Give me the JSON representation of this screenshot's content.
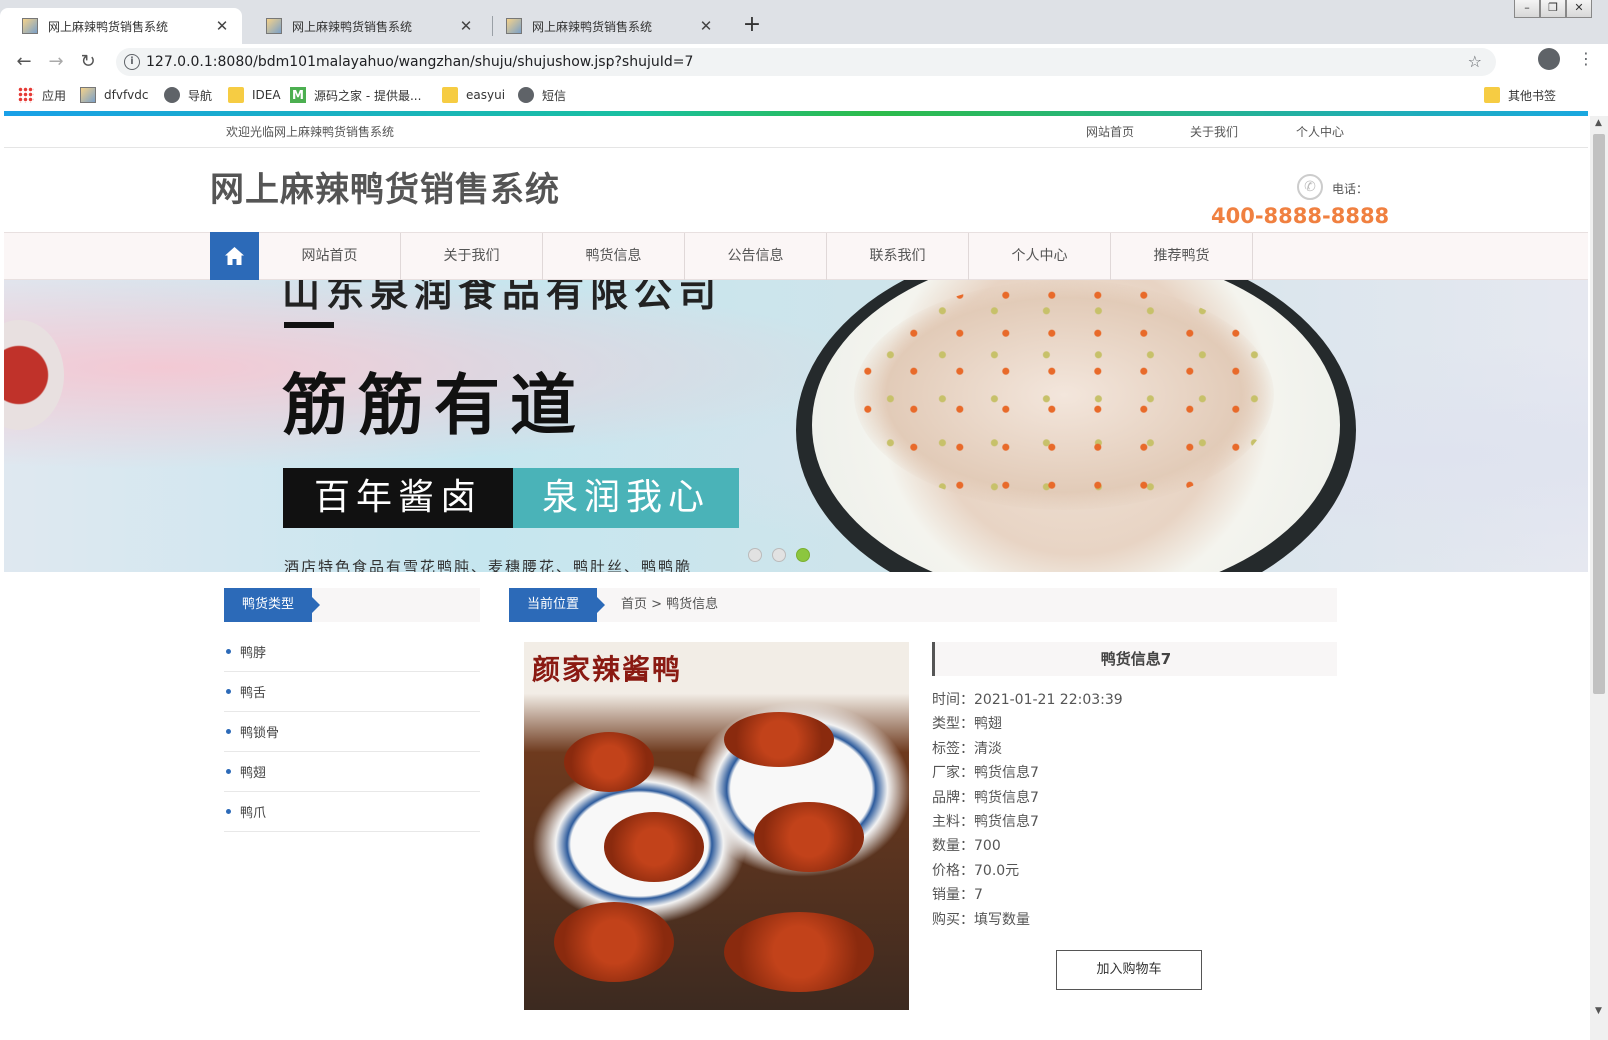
{
  "browser": {
    "tabs": [
      {
        "title": "网上麻辣鸭货销售系统",
        "active": true
      },
      {
        "title": "网上麻辣鸭货销售系统",
        "active": false
      },
      {
        "title": "网上麻辣鸭货销售系统",
        "active": false
      }
    ],
    "new_tab": "+",
    "url": "127.0.0.1:8080/bdm101malayahuo/wangzhan/shuju/shujushow.jsp?shujuId=7",
    "bookmarks": [
      {
        "label": "应用",
        "icon": "apps-icon"
      },
      {
        "label": "dfvfvdc",
        "icon": "image-icon"
      },
      {
        "label": "导航",
        "icon": "globe-icon"
      },
      {
        "label": "IDEA",
        "icon": "folder-icon"
      },
      {
        "label": "源码之家 - 提供最...",
        "icon": "m-icon"
      },
      {
        "label": "easyui",
        "icon": "folder-icon"
      },
      {
        "label": "短信",
        "icon": "globe-icon"
      }
    ],
    "other_bookmarks": "其他书签"
  },
  "site": {
    "welcome": "欢迎光临网上麻辣鸭货销售系统",
    "top_links": [
      "网站首页",
      "关于我们",
      "个人中心"
    ],
    "name": "网上麻辣鸭货销售系统",
    "phone_label": "电话：",
    "phone_number": "400-8888-8888",
    "nav": [
      "网站首页",
      "关于我们",
      "鸭货信息",
      "公告信息",
      "联系我们",
      "个人中心",
      "推荐鸭货"
    ]
  },
  "banner": {
    "top_line": "山东泉润食品有限公司",
    "title": "筋筋有道",
    "slogan_left": "百年酱卤",
    "slogan_right": "泉润我心",
    "description": "酒店特色食品有雪花鸭肫、麦穗腰花、鸭肚丝、鸭鸭脆",
    "active_slide": 3,
    "slide_count": 3
  },
  "sidebar": {
    "heading": "鸭货类型",
    "categories": [
      "鸭脖",
      "鸭舌",
      "鸭锁骨",
      "鸭翅",
      "鸭爪"
    ]
  },
  "content": {
    "location_tag": "当前位置",
    "breadcrumb": "首页 > 鸭货信息",
    "image_brand": "颜家辣酱鸭",
    "product": {
      "title": "鸭货信息7",
      "rows": [
        "时间：2021-01-21 22:03:39",
        "类型：鸭翅",
        "标签：清淡",
        "厂家：鸭货信息7",
        "品牌：鸭货信息7",
        "主料：鸭货信息7",
        "数量：700",
        "价格：70.0元",
        "销量：7",
        "购买：填写数量"
      ],
      "add_to_cart": "加入购物车"
    }
  },
  "colors": {
    "primary_blue": "#2c6ab8",
    "phone_orange": "#f08040",
    "active_dot": "#8cc63f"
  }
}
